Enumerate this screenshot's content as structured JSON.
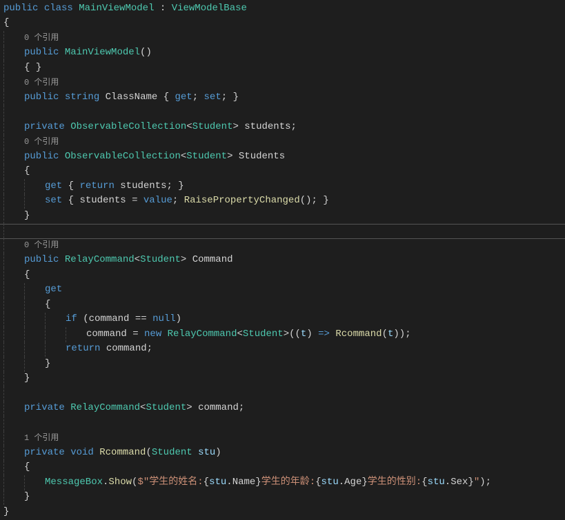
{
  "tokens": {
    "public": "public",
    "class": "class",
    "MainViewModel": "MainViewModel",
    "colon": ":",
    "ViewModelBase": "ViewModelBase",
    "lbrace": "{",
    "rbrace": "}",
    "ref0": "0 个引用",
    "ref1": "1 个引用",
    "MainViewModel_ctor": "MainViewModel",
    "lparen": "(",
    "rparen": ")",
    "string": "string",
    "ClassName": "ClassName",
    "get": "get",
    "set": "set",
    "semi": ";",
    "private": "private",
    "ObservableCollection": "ObservableCollection",
    "lt": "<",
    "gt": ">",
    "Student": "Student",
    "students": "students",
    "Students": "Students",
    "return": "return",
    "eq": "=",
    "value": "value",
    "RaisePropertyChanged": "RaisePropertyChanged",
    "RelayCommand": "RelayCommand",
    "Command": "Command",
    "if": "if",
    "command": "command",
    "eqeq": "==",
    "null": "null",
    "new": "new",
    "t": "t",
    "arrow": "=>",
    "Rcommand": "Rcommand",
    "void": "void",
    "stu": "stu",
    "MessageBox": "MessageBox",
    "dot": ".",
    "Show": "Show",
    "dollar": "$",
    "quote": "\"",
    "str_name": "学生的姓名:",
    "Name": "Name",
    "str_age": "学生的年龄:",
    "Age": "Age",
    "str_sex": "学生的性别:",
    "Sex": "Sex",
    "lbrace_interp": "{",
    "rbrace_interp": "}",
    "comma": ","
  }
}
